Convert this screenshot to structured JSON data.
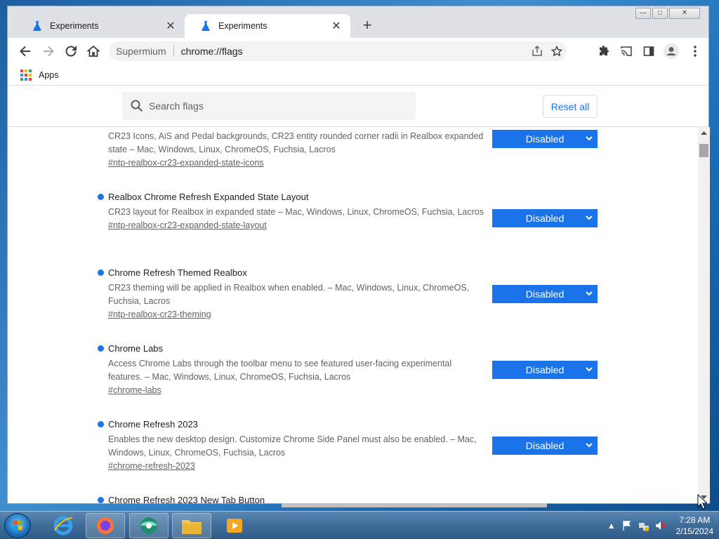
{
  "browser": {
    "tabs": [
      {
        "title": "Experiments",
        "active": false
      },
      {
        "title": "Experiments",
        "active": true
      }
    ],
    "window_controls": {
      "minimize": "—",
      "maximize": "□",
      "close": "✕"
    },
    "omnibox": {
      "site": "Supermium",
      "url": "chrome://flags"
    },
    "bookmarks": {
      "apps_label": "Apps"
    }
  },
  "flags_page": {
    "search_placeholder": "Search flags",
    "reset_all_label": "Reset all",
    "flags": [
      {
        "name": "",
        "description": "CR23 Icons, AiS and Pedal backgrounds, CR23 entity rounded corner radii in Realbox expanded state – Mac, Windows, Linux, ChromeOS, Fuchsia, Lacros",
        "link": "#ntp-realbox-cr23-expanded-state-icons",
        "value": "Disabled"
      },
      {
        "name": "Realbox Chrome Refresh Expanded State Layout",
        "description": "CR23 layout for Realbox in expanded state – Mac, Windows, Linux, ChromeOS, Fuchsia, Lacros",
        "link": "#ntp-realbox-cr23-expanded-state-layout",
        "value": "Disabled"
      },
      {
        "name": "Chrome Refresh Themed Realbox",
        "description": "CR23 theming will be applied in Realbox when enabled. – Mac, Windows, Linux, ChromeOS, Fuchsia, Lacros",
        "link": "#ntp-realbox-cr23-theming",
        "value": "Disabled"
      },
      {
        "name": "Chrome Labs",
        "description": "Access Chrome Labs through the toolbar menu to see featured user-facing experimental features. – Mac, Windows, Linux, ChromeOS, Fuchsia, Lacros",
        "link": "#chrome-labs",
        "value": "Disabled"
      },
      {
        "name": "Chrome Refresh 2023",
        "description": "Enables the new desktop design. Customize Chrome Side Panel must also be enabled. – Mac, Windows, Linux, ChromeOS, Fuchsia, Lacros",
        "link": "#chrome-refresh-2023",
        "value": "Disabled"
      },
      {
        "name": "Chrome Refresh 2023 New Tab Button",
        "description": "",
        "link": "",
        "value": ""
      }
    ]
  },
  "taskbar": {
    "clock_time": "7:28 AM",
    "clock_date": "2/15/2024"
  },
  "colors": {
    "accent": "#1a73e8",
    "tab_strip": "#dee1e6",
    "taskbar": "#3e6c99"
  }
}
